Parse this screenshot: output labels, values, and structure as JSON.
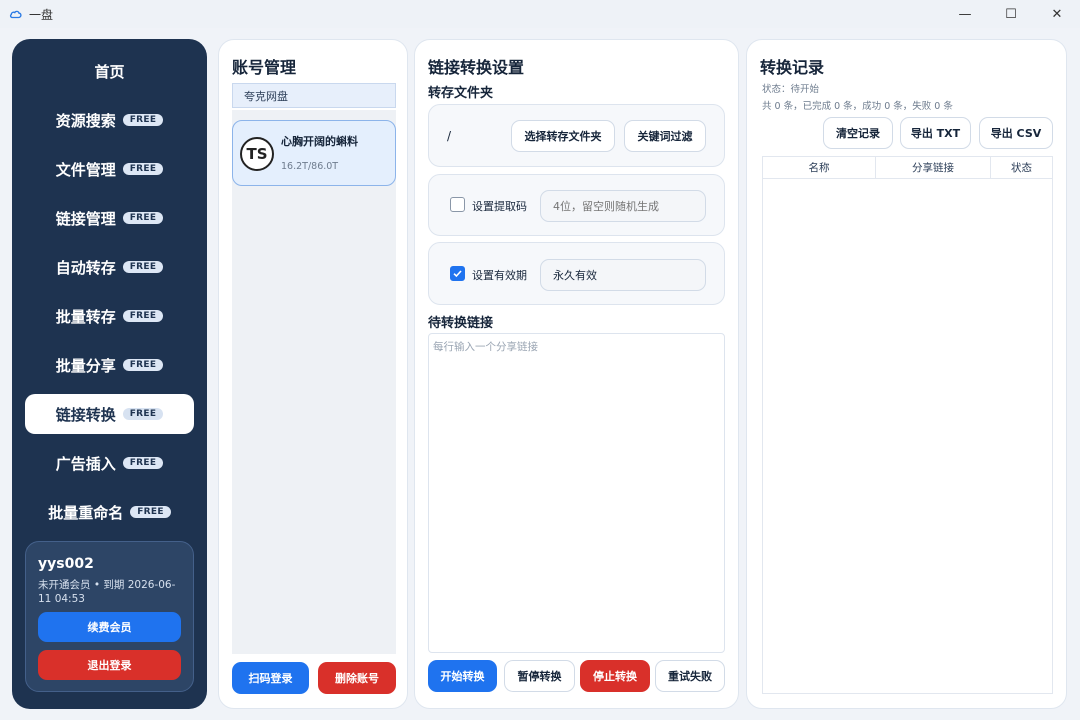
{
  "window": {
    "title": "一盘",
    "minimize": "—",
    "maximize": "☐",
    "close": "✕"
  },
  "sidebar": {
    "items": [
      {
        "label": "首页",
        "badge": ""
      },
      {
        "label": "资源搜索",
        "badge": "FREE"
      },
      {
        "label": "文件管理",
        "badge": "FREE"
      },
      {
        "label": "链接管理",
        "badge": "FREE"
      },
      {
        "label": "自动转存",
        "badge": "FREE"
      },
      {
        "label": "批量转存",
        "badge": "FREE"
      },
      {
        "label": "批量分享",
        "badge": "FREE"
      },
      {
        "label": "链接转换",
        "badge": "FREE",
        "active": true
      },
      {
        "label": "广告插入",
        "badge": "FREE"
      },
      {
        "label": "批量重命名",
        "badge": "FREE"
      }
    ],
    "user": {
      "name": "yys002",
      "meta": "未开通会员 • 到期 2026-06-11 04:53",
      "renew": "续费会员",
      "logout": "退出登录"
    }
  },
  "accounts": {
    "title": "账号管理",
    "tab": "夸克网盘",
    "items": [
      {
        "name": "心胸开阔的蝌料",
        "size": "16.2T/86.0T",
        "avatar": "TS"
      }
    ],
    "scan_login": "扫码登录",
    "delete_account": "删除账号"
  },
  "settings": {
    "title": "链接转换设置",
    "folder_label": "转存文件夹",
    "folder_path": "/",
    "choose_folder": "选择转存文件夹",
    "keyword_filter": "关键词过滤",
    "extract_code_label": "设置提取码",
    "extract_code_checked": false,
    "extract_code_placeholder": "4位，留空则随机生成",
    "validity_label": "设置有效期",
    "validity_checked": true,
    "validity_value": "永久有效",
    "pending_label": "待转换链接",
    "pending_placeholder": "每行输入一个分享链接",
    "start": "开始转换",
    "pause": "暂停转换",
    "stop": "停止转换",
    "retry": "重试失败"
  },
  "records": {
    "title": "转换记录",
    "status": "状态：待开始",
    "summary": "共 0 条，已完成 0 条，成功 0 条，失败 0 条",
    "clear": "清空记录",
    "export_txt": "导出 TXT",
    "export_csv": "导出 CSV",
    "columns": [
      "名称",
      "分享链接",
      "状态"
    ]
  },
  "colors": {
    "sidebar_bg": "#1e3350",
    "primary": "#1f73ef",
    "danger": "#d9302a"
  }
}
